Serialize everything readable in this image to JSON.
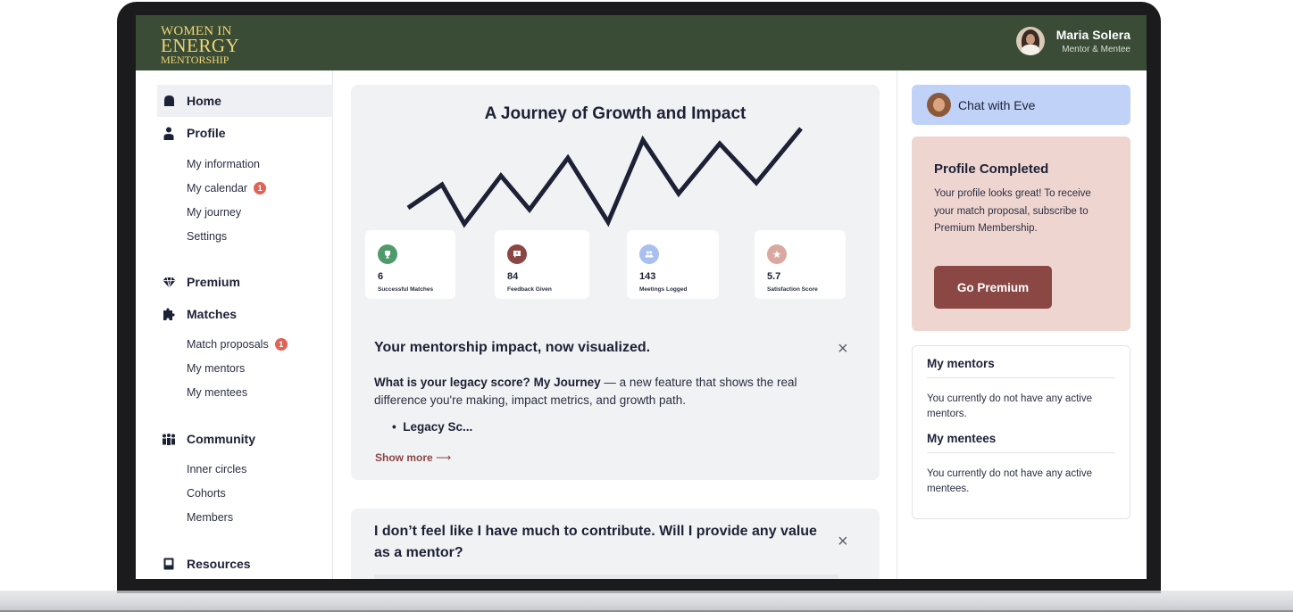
{
  "brand": {
    "line1": "WOMEN IN",
    "line2": "ENERGY",
    "line3": "MENTORSHIP"
  },
  "user": {
    "name": "Maria Solera",
    "role": "Mentor & Mentee"
  },
  "sidebar": {
    "home": "Home",
    "profile": "Profile",
    "profile_items": [
      {
        "label": "My information"
      },
      {
        "label": "My calendar",
        "badge": "1"
      },
      {
        "label": "My journey"
      },
      {
        "label": "Settings"
      }
    ],
    "premium": "Premium",
    "matches": "Matches",
    "matches_items": [
      {
        "label": "Match proposals",
        "badge": "1"
      },
      {
        "label": "My mentors"
      },
      {
        "label": "My mentees"
      }
    ],
    "community": "Community",
    "community_items": [
      {
        "label": "Inner circles"
      },
      {
        "label": "Cohorts"
      },
      {
        "label": "Members"
      }
    ],
    "resources": "Resources"
  },
  "hero": {
    "title": "A Journey of Growth and Impact",
    "stats": [
      {
        "value": "6",
        "label": "Successful Matches",
        "color": "#4f9a6a",
        "icon": "trophy-icon"
      },
      {
        "value": "84",
        "label": "Feedback Given",
        "color": "#8a4744",
        "icon": "feedback-icon"
      },
      {
        "value": "143",
        "label": "Meetings Logged",
        "color": "#a9bff0",
        "icon": "people-icon"
      },
      {
        "value": "5.7",
        "label": "Satisfaction Score",
        "color": "#d9a8a0",
        "icon": "star-icon"
      }
    ]
  },
  "impact": {
    "title": "Your mentorship impact, now visualized.",
    "body_bold1": "What is your legacy score?",
    "body_bold2": "My Journey",
    "body_rest": "— a new feature that shows the real difference you're making, impact metrics, and growth path.",
    "bullet": "Legacy Sc...",
    "show_more": "Show more"
  },
  "faq": {
    "title": "I don’t feel like I have much to contribute. Will I provide any value as a mentor?"
  },
  "chat": {
    "label": "Chat with Eve"
  },
  "premium_card": {
    "title": "Profile Completed",
    "body": "Your profile looks great! To receive your match proposal, subscribe to Premium Membership.",
    "button": "Go Premium"
  },
  "relations": {
    "mentors_title": "My mentors",
    "mentors_text": "You currently do not have any active mentors.",
    "mentees_title": "My mentees",
    "mentees_text": "You currently do not have any active mentees."
  },
  "colors": {
    "header": "#3a4c36",
    "brand": "#f1d673",
    "accent": "#8a4744",
    "chat": "#c0d2f7",
    "premium_bg": "#efd5d0",
    "badge": "#e06456"
  }
}
